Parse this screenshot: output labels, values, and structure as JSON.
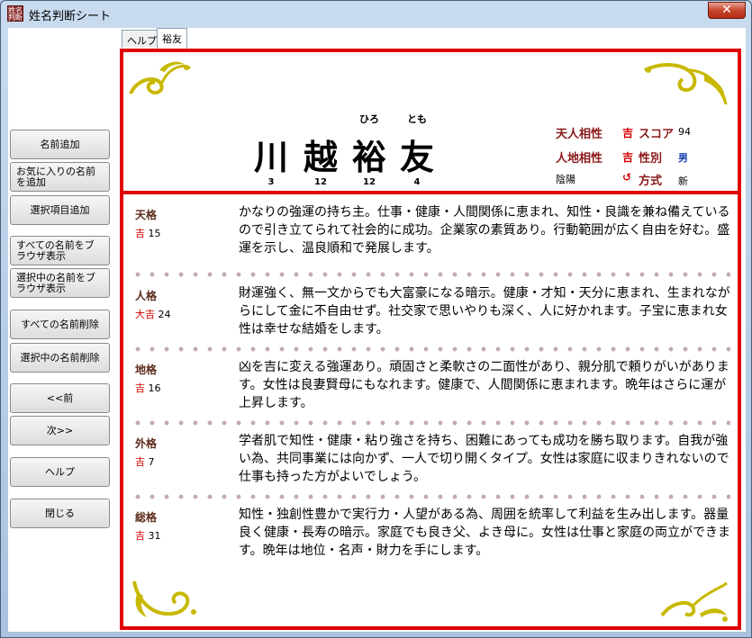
{
  "window": {
    "title": "姓名判断シート",
    "icon_text": "姓名判断",
    "close_glyph": "✕"
  },
  "sidebar": {
    "buttons": [
      {
        "label": "名前追加"
      },
      {
        "label": "お気に入りの名前を追加"
      },
      {
        "label": "選択項目追加"
      },
      {
        "label": "すべての名前をブラウザ表示"
      },
      {
        "label": "選択中の名前をブラウザ表示"
      },
      {
        "label": "すべての名前削除"
      },
      {
        "label": "選択中の名前削除"
      },
      {
        "label": "<<前"
      },
      {
        "label": "次>>"
      },
      {
        "label": "ヘルプ"
      },
      {
        "label": "閉じる"
      }
    ]
  },
  "tabs": [
    {
      "label": "ヘルプ"
    },
    {
      "label": "裕友"
    }
  ],
  "name": {
    "chars": [
      "川",
      "越",
      "裕",
      "友"
    ],
    "furigana": [
      "",
      "",
      "ひろ",
      "とも"
    ],
    "strokes": [
      "3",
      "12",
      "12",
      "4"
    ]
  },
  "summary": {
    "tenjin_label": "天人相性",
    "tenjin_value": "吉",
    "score_label": "スコア",
    "score_value": "94",
    "jinchi_label": "人地相性",
    "jinchi_value": "吉",
    "gender_label": "性別",
    "gender_value": "男",
    "inyo_label": "陰陽",
    "inyo_value": "↺",
    "method_label": "方式",
    "method_value": "新"
  },
  "entries": [
    {
      "name": "天格",
      "luck": "吉",
      "number": "15",
      "text": "かなりの強運の持ち主。仕事・健康・人間関係に恵まれ、知性・良識を兼ね備えているので引き立てられて社会的に成功。企業家の素質あり。行動範囲が広く自由を好む。盛運を示し、温良順和で発展します。"
    },
    {
      "name": "人格",
      "luck": "大吉",
      "number": "24",
      "text": "財運強く、無一文からでも大富豪になる暗示。健康・才知・天分に恵まれ、生まれながらにして金に不自由せず。社交家で思いやりも深く、人に好かれます。子宝に恵まれ女性は幸せな結婚をします。"
    },
    {
      "name": "地格",
      "luck": "吉",
      "number": "16",
      "text": "凶を吉に変える強運あり。頑固さと柔軟さの二面性があり、親分肌で頼りがいがあります。女性は良妻賢母にもなれます。健康で、人間関係に恵まれます。晩年はさらに運が上昇します。"
    },
    {
      "name": "外格",
      "luck": "吉",
      "number": "7",
      "text": "学者肌で知性・健康・粘り強さを持ち、困難にあっても成功を勝ち取ります。自我が強い為、共同事業には向かず、一人で切り開くタイプ。女性は家庭に収まりきれないので仕事も持った方がよいでしょう。"
    },
    {
      "name": "総格",
      "luck": "吉",
      "number": "31",
      "text": "知性・独創性豊かで実行力・人望がある為、周囲を統率して利益を生み出します。器量良く健康・長寿の暗示。家庭でも良き父、よき母に。女性は仕事と家庭の両立ができます。晩年は地位・名声・財力を手にします。"
    }
  ]
}
